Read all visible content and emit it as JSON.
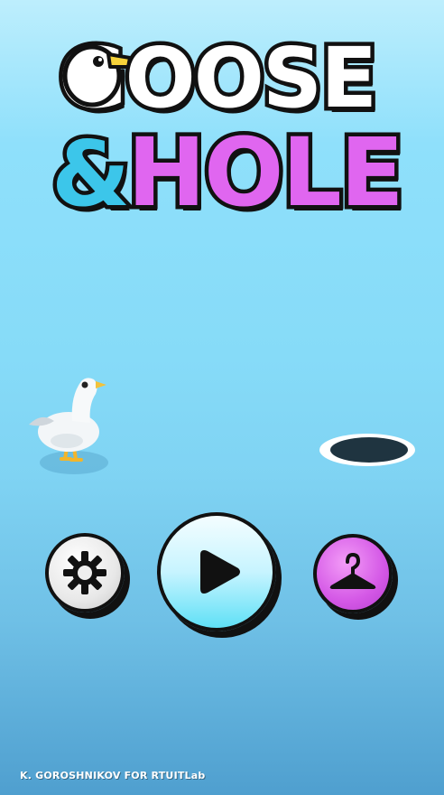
{
  "title": {
    "line1": "GOOSE",
    "ampersand": "&",
    "line2": "HOLE",
    "colors": {
      "line1": "#ffffff",
      "ampersand": "#3cc6ea",
      "line2": "#e066f0",
      "outline": "#111111"
    }
  },
  "buttons": {
    "settings": {
      "icon": "gear-icon",
      "color": "#e8e8e8"
    },
    "play": {
      "icon": "play-icon",
      "color": "#7fe6f7"
    },
    "wardrobe": {
      "icon": "hanger-icon",
      "color": "#d458e6"
    }
  },
  "scene": {
    "character": "goose",
    "target": "hole"
  },
  "footer": {
    "credit": "K. GOROSHNIKOV FOR RTUITLab"
  }
}
